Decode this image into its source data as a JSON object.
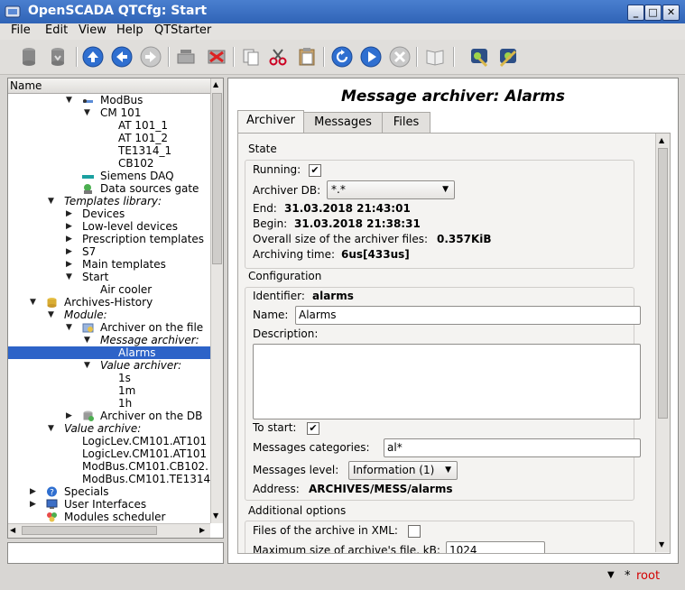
{
  "window": {
    "title": "OpenSCADA QTCfg: Start",
    "btn_min": "_",
    "btn_max": "□",
    "btn_close": "✕"
  },
  "menu": [
    "File",
    "Edit",
    "View",
    "Help",
    "QTStarter"
  ],
  "tree": {
    "header": "Name",
    "items": [
      {
        "label": "ModBus",
        "italic": false
      },
      {
        "label": "CM 101",
        "italic": false
      },
      {
        "label": "AT 101_1",
        "italic": false
      },
      {
        "label": "AT 101_2",
        "italic": false
      },
      {
        "label": "TE1314_1",
        "italic": false
      },
      {
        "label": "CB102",
        "italic": false
      },
      {
        "label": "Siemens DAQ",
        "italic": false
      },
      {
        "label": "Data sources gate",
        "italic": false
      },
      {
        "label": "Templates library:",
        "italic": true
      },
      {
        "label": "Devices",
        "italic": false
      },
      {
        "label": "Low-level devices",
        "italic": false
      },
      {
        "label": "Prescription templates",
        "italic": false
      },
      {
        "label": "S7",
        "italic": false
      },
      {
        "label": "Main templates",
        "italic": false
      },
      {
        "label": "Start",
        "italic": false
      },
      {
        "label": "Air cooler",
        "italic": false
      },
      {
        "label": "Archives-History",
        "italic": false
      },
      {
        "label": "Module:",
        "italic": true
      },
      {
        "label": "Archiver on the file",
        "italic": false
      },
      {
        "label": "Message archiver:",
        "italic": true
      },
      {
        "label": "Alarms",
        "italic": false
      },
      {
        "label": "Value archiver:",
        "italic": true
      },
      {
        "label": "1s",
        "italic": false
      },
      {
        "label": "1m",
        "italic": false
      },
      {
        "label": "1h",
        "italic": false
      },
      {
        "label": "Archiver on the DB",
        "italic": false
      },
      {
        "label": "Value archive:",
        "italic": true
      },
      {
        "label": "LogicLev.CM101.AT101",
        "italic": false
      },
      {
        "label": "LogicLev.CM101.AT101",
        "italic": false
      },
      {
        "label": "ModBus.CM101.CB102.",
        "italic": false
      },
      {
        "label": "ModBus.CM101.TE1314",
        "italic": false
      },
      {
        "label": "Specials",
        "italic": false
      },
      {
        "label": "User Interfaces",
        "italic": false
      },
      {
        "label": "Modules scheduler",
        "italic": false
      }
    ]
  },
  "page": {
    "title": "Message archiver: Alarms",
    "tabs": [
      "Archiver",
      "Messages",
      "Files"
    ],
    "state": {
      "heading": "State",
      "running_label": "Running:",
      "running_checked": true,
      "db_label": "Archiver DB:",
      "db_value": "*.*",
      "end_label": "End:",
      "end_value": "31.03.2018 21:43:01",
      "begin_label": "Begin:",
      "begin_value": "31.03.2018 21:38:31",
      "size_label": "Overall size of the archiver files:",
      "size_value": "0.357KiB",
      "time_label": "Archiving time:",
      "time_value": "6us[433us]"
    },
    "config": {
      "heading": "Configuration",
      "id_label": "Identifier:",
      "id_value": "alarms",
      "name_label": "Name:",
      "name_value": "Alarms",
      "desc_label": "Description:",
      "desc_value": "",
      "start_label": "To start:",
      "start_checked": true,
      "cat_label": "Messages categories:",
      "cat_value": "al*",
      "level_label": "Messages level:",
      "level_value": "Information (1)",
      "addr_label": "Address:",
      "addr_value": "ARCHIVES/MESS/alarms"
    },
    "additional": {
      "heading": "Additional options",
      "xml_label": "Files of the archive in XML:",
      "xml_checked": false,
      "maxsize_label": "Maximum size of archive's file, kB:",
      "maxsize_value": "1024"
    }
  },
  "status": {
    "user": "root",
    "marker": "*"
  }
}
